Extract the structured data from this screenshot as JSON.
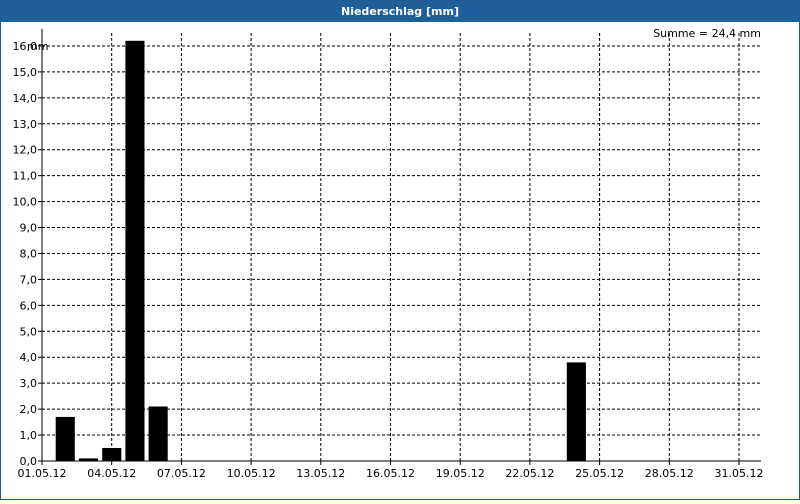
{
  "window": {
    "title": "Niederschlag [mm]"
  },
  "chart_data": {
    "type": "bar",
    "title": "Niederschlag [mm]",
    "ylabel": "mm",
    "summary": "Summe = 24,4 mm",
    "ylim": [
      0,
      16.5
    ],
    "yticks": [
      "0,0",
      "1,0",
      "2,0",
      "3,0",
      "4,0",
      "5,0",
      "6,0",
      "7,0",
      "8,0",
      "9,0",
      "10,0",
      "11,0",
      "12,0",
      "13,0",
      "14,0",
      "15,0",
      "16,0"
    ],
    "xticks": [
      "01.05.12",
      "04.05.12",
      "07.05.12",
      "10.05.12",
      "13.05.12",
      "16.05.12",
      "19.05.12",
      "22.05.12",
      "25.05.12",
      "28.05.12",
      "31.05.12"
    ],
    "grid": true,
    "bar_color": "#000000",
    "data": [
      {
        "date": "02.05.12",
        "value": 1.7
      },
      {
        "date": "03.05.12",
        "value": 0.1
      },
      {
        "date": "04.05.12",
        "value": 0.5
      },
      {
        "date": "05.05.12",
        "value": 16.2
      },
      {
        "date": "06.05.12",
        "value": 2.1
      },
      {
        "date": "24.05.12",
        "value": 3.8
      }
    ]
  }
}
